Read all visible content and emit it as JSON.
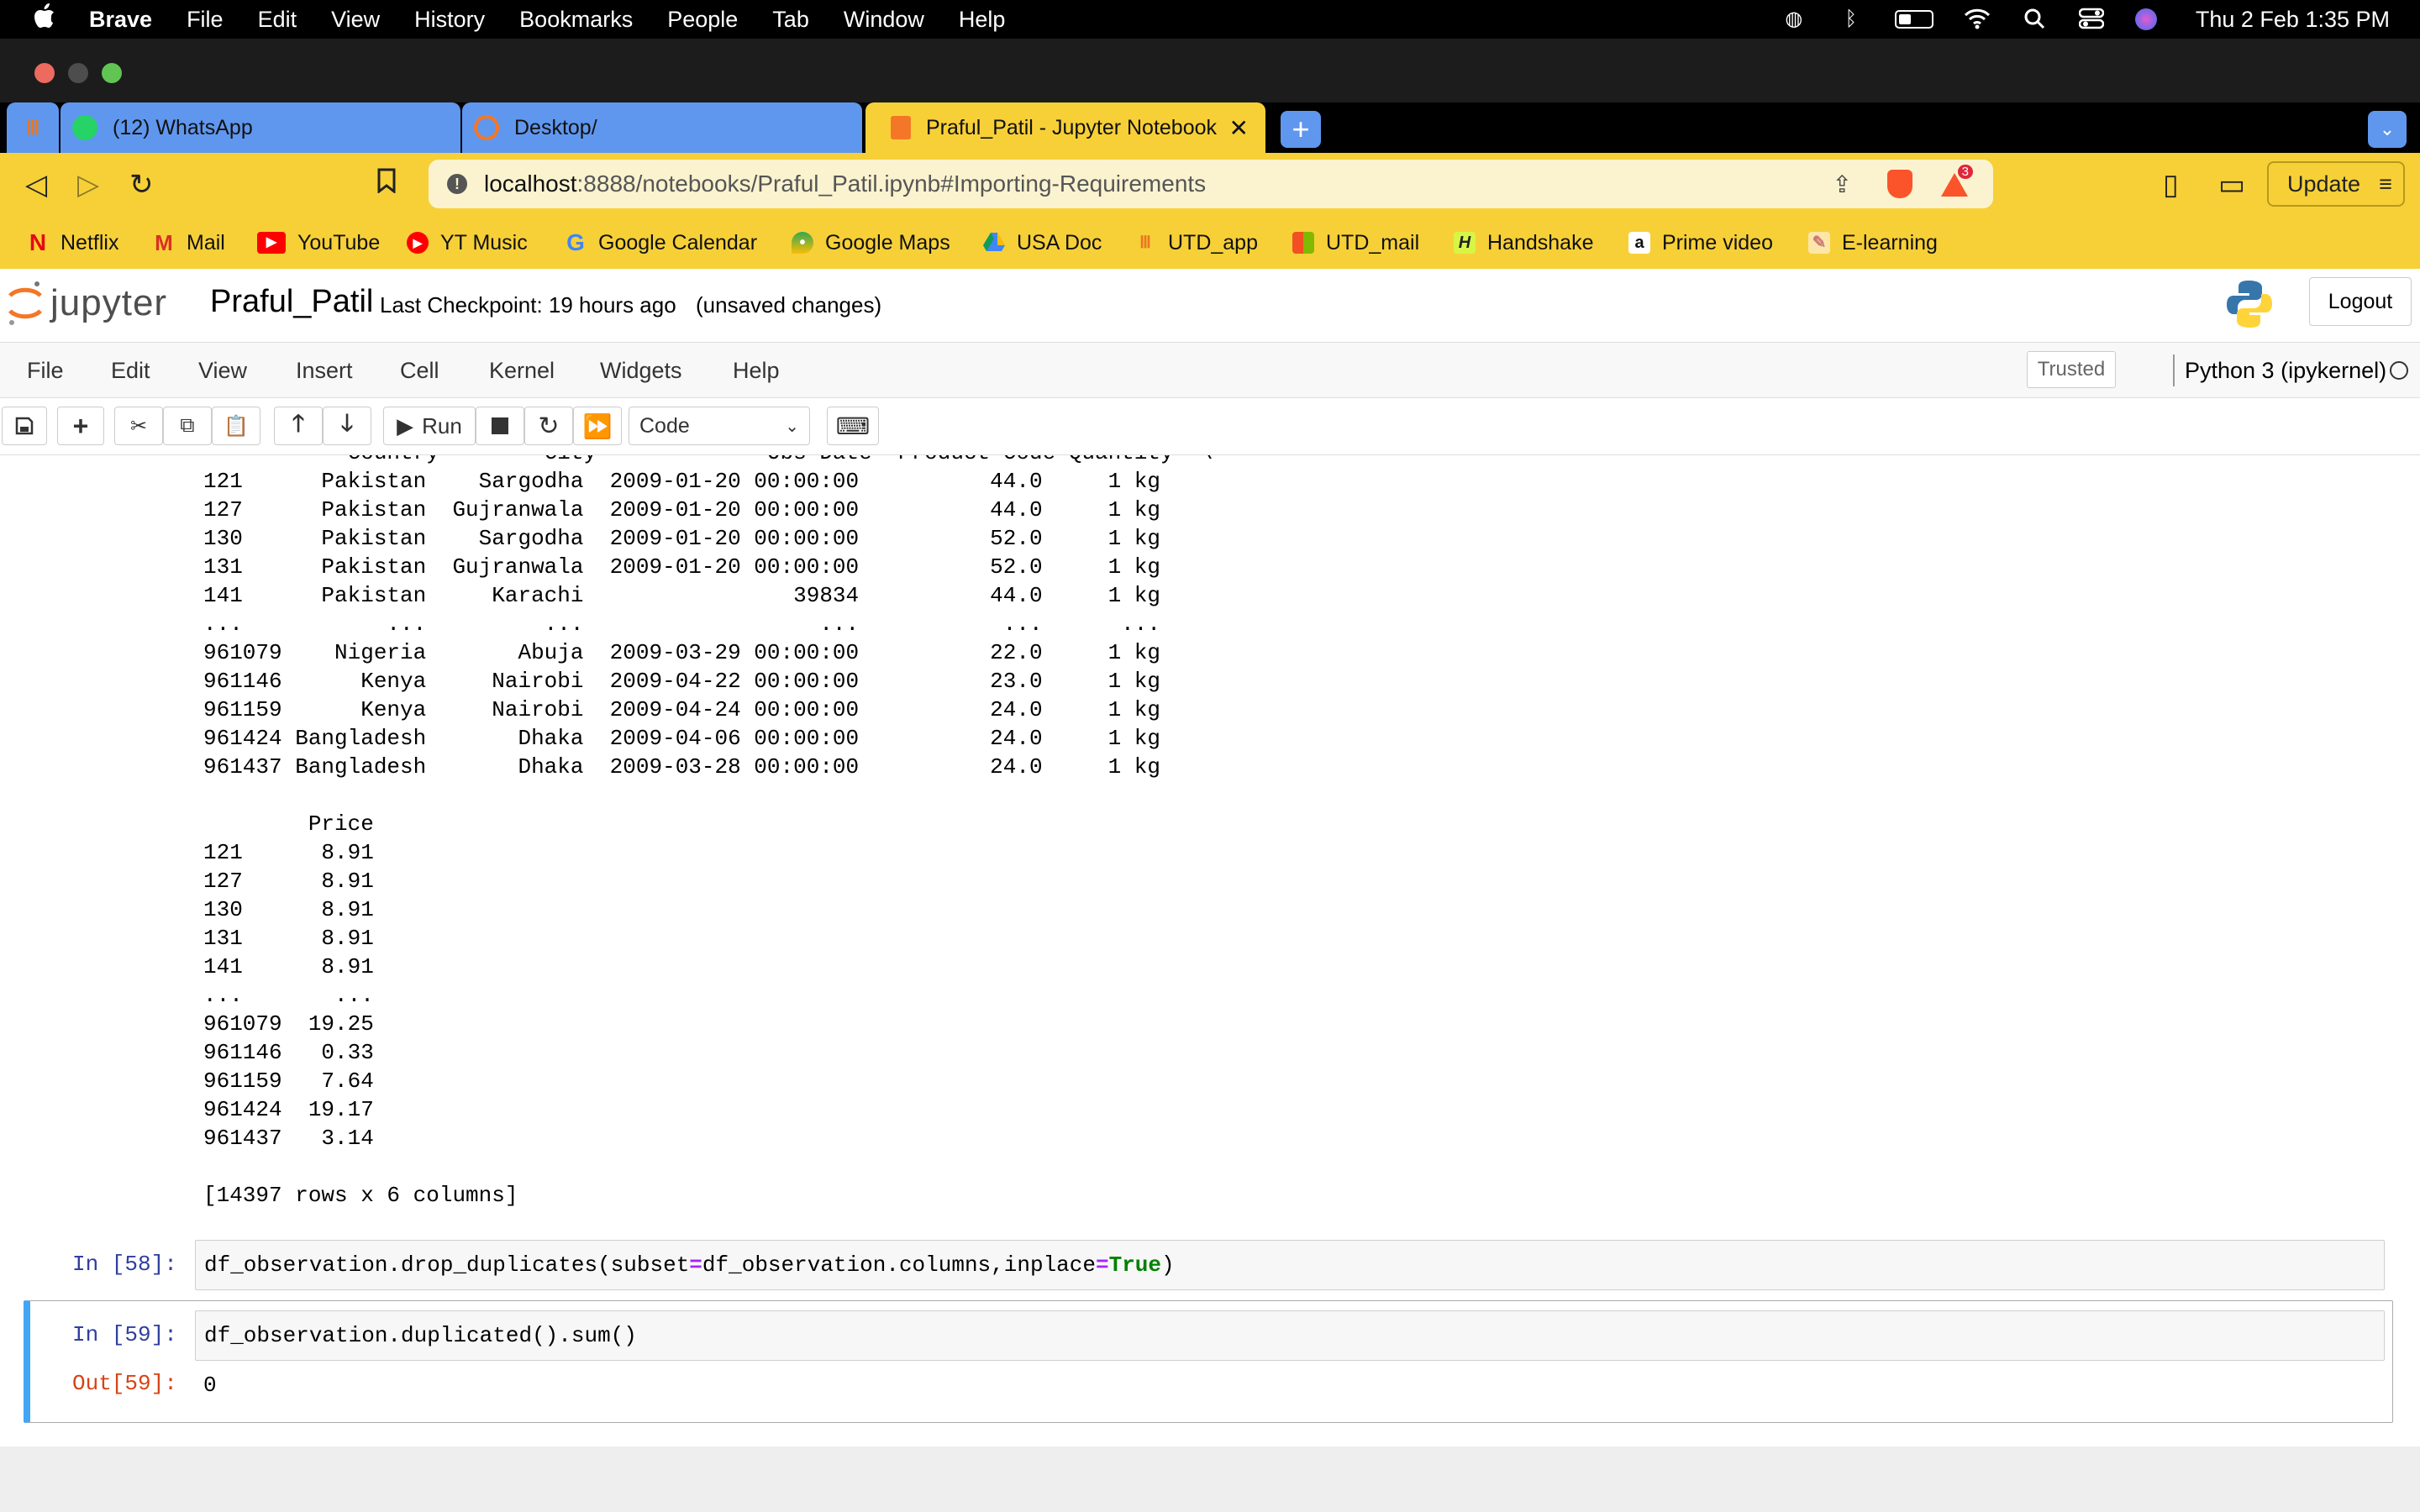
{
  "menubar": {
    "apple": "",
    "app": "Brave",
    "items": [
      "File",
      "Edit",
      "View",
      "History",
      "Bookmarks",
      "People",
      "Tab",
      "Window",
      "Help"
    ],
    "datetime": "Thu 2 Feb  1:35 PM"
  },
  "tabs": [
    {
      "label": "(12) WhatsApp",
      "active": false
    },
    {
      "label": "Desktop/",
      "active": false
    },
    {
      "label": "Praful_Patil - Jupyter Notebook",
      "active": true
    }
  ],
  "url": {
    "host": "localhost",
    "rest": ":8888/notebooks/Praful_Patil.ipynb#Importing-Requirements"
  },
  "update_label": "Update",
  "shields_count": "3",
  "bookmarks": [
    "Netflix",
    "Mail",
    "YouTube",
    "YT Music",
    "Google Calendar",
    "Google Maps",
    "USA Doc",
    "UTD_app",
    "UTD_mail",
    "Handshake",
    "Prime video",
    "E-learning"
  ],
  "jupyter": {
    "logo": "jupyter",
    "notebook_name": "Praful_Patil",
    "checkpoint": "Last Checkpoint: 19 hours ago",
    "unsaved": "(unsaved changes)",
    "logout": "Logout",
    "menu": [
      "File",
      "Edit",
      "View",
      "Insert",
      "Cell",
      "Kernel",
      "Widgets",
      "Help"
    ],
    "trusted": "Trusted",
    "kernel": "Python 3 (ipykernel)",
    "run_label": "Run",
    "cell_type": "Code"
  },
  "output_head_partial": "           Country        City             Obs Date  Product Code Quantity  \\",
  "table1": [
    [
      "121",
      "Pakistan",
      "Sargodha",
      "2009-01-20 00:00:00",
      "44.0",
      "1 kg"
    ],
    [
      "127",
      "Pakistan",
      "Gujranwala",
      "2009-01-20 00:00:00",
      "44.0",
      "1 kg"
    ],
    [
      "130",
      "Pakistan",
      "Sargodha",
      "2009-01-20 00:00:00",
      "52.0",
      "1 kg"
    ],
    [
      "131",
      "Pakistan",
      "Gujranwala",
      "2009-01-20 00:00:00",
      "52.0",
      "1 kg"
    ],
    [
      "141",
      "Pakistan",
      "Karachi",
      "39834",
      "44.0",
      "1 kg"
    ],
    [
      "...",
      "...",
      "...",
      "...",
      "...",
      "..."
    ],
    [
      "961079",
      "Nigeria",
      "Abuja",
      "2009-03-29 00:00:00",
      "22.0",
      "1 kg"
    ],
    [
      "961146",
      "Kenya",
      "Nairobi",
      "2009-04-22 00:00:00",
      "23.0",
      "1 kg"
    ],
    [
      "961159",
      "Kenya",
      "Nairobi",
      "2009-04-24 00:00:00",
      "24.0",
      "1 kg"
    ],
    [
      "961424",
      "Bangladesh",
      "Dhaka",
      "2009-04-06 00:00:00",
      "24.0",
      "1 kg"
    ],
    [
      "961437",
      "Bangladesh",
      "Dhaka",
      "2009-03-28 00:00:00",
      "24.0",
      "1 kg"
    ]
  ],
  "price_header": "Price",
  "table2": [
    [
      "121",
      "8.91"
    ],
    [
      "127",
      "8.91"
    ],
    [
      "130",
      "8.91"
    ],
    [
      "131",
      "8.91"
    ],
    [
      "141",
      "8.91"
    ],
    [
      "...",
      "..."
    ],
    [
      "961079",
      "19.25"
    ],
    [
      "961146",
      "0.33"
    ],
    [
      "961159",
      "7.64"
    ],
    [
      "961424",
      "19.17"
    ],
    [
      "961437",
      "3.14"
    ]
  ],
  "shape_note": "[14397 rows x 6 columns]",
  "cell58": {
    "prompt": "In [58]:",
    "pre": "df_observation.drop_duplicates(subset",
    "eq1": "=",
    "mid": "df_observation.columns,inplace",
    "eq2": "=",
    "kw": "True",
    "post": ")"
  },
  "cell59": {
    "prompt": "In [59]:",
    "code": "df_observation.duplicated().sum()",
    "out_prompt": "Out[59]:",
    "out": "0"
  }
}
